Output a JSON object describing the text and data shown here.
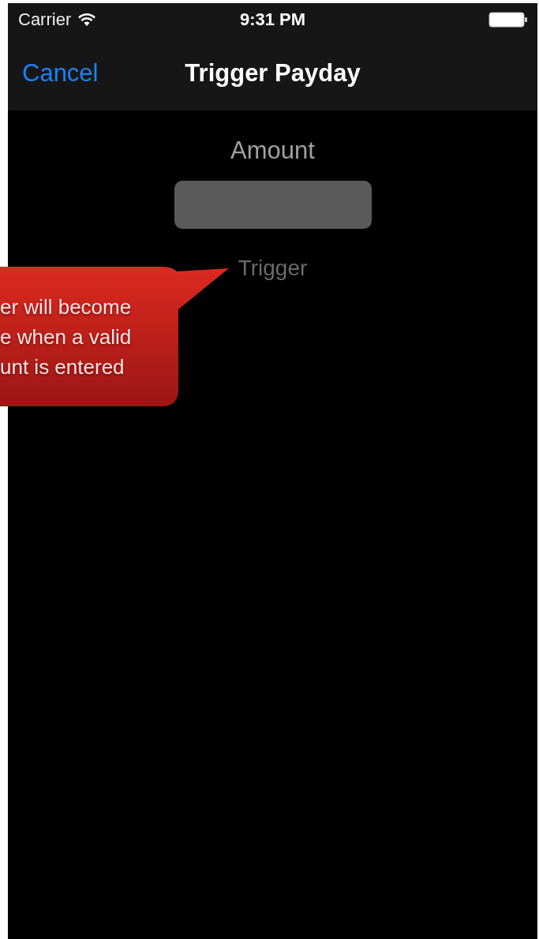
{
  "status_bar": {
    "carrier": "Carrier",
    "time": "9:31 PM"
  },
  "nav_bar": {
    "left_button": "Cancel",
    "title": "Trigger Payday"
  },
  "form": {
    "label": "Amount",
    "button": {
      "label": "Trigger",
      "disabled": true
    }
  },
  "callout": {
    "lines": [
      "er will become",
      "e when a valid",
      "unt is entered"
    ]
  }
}
